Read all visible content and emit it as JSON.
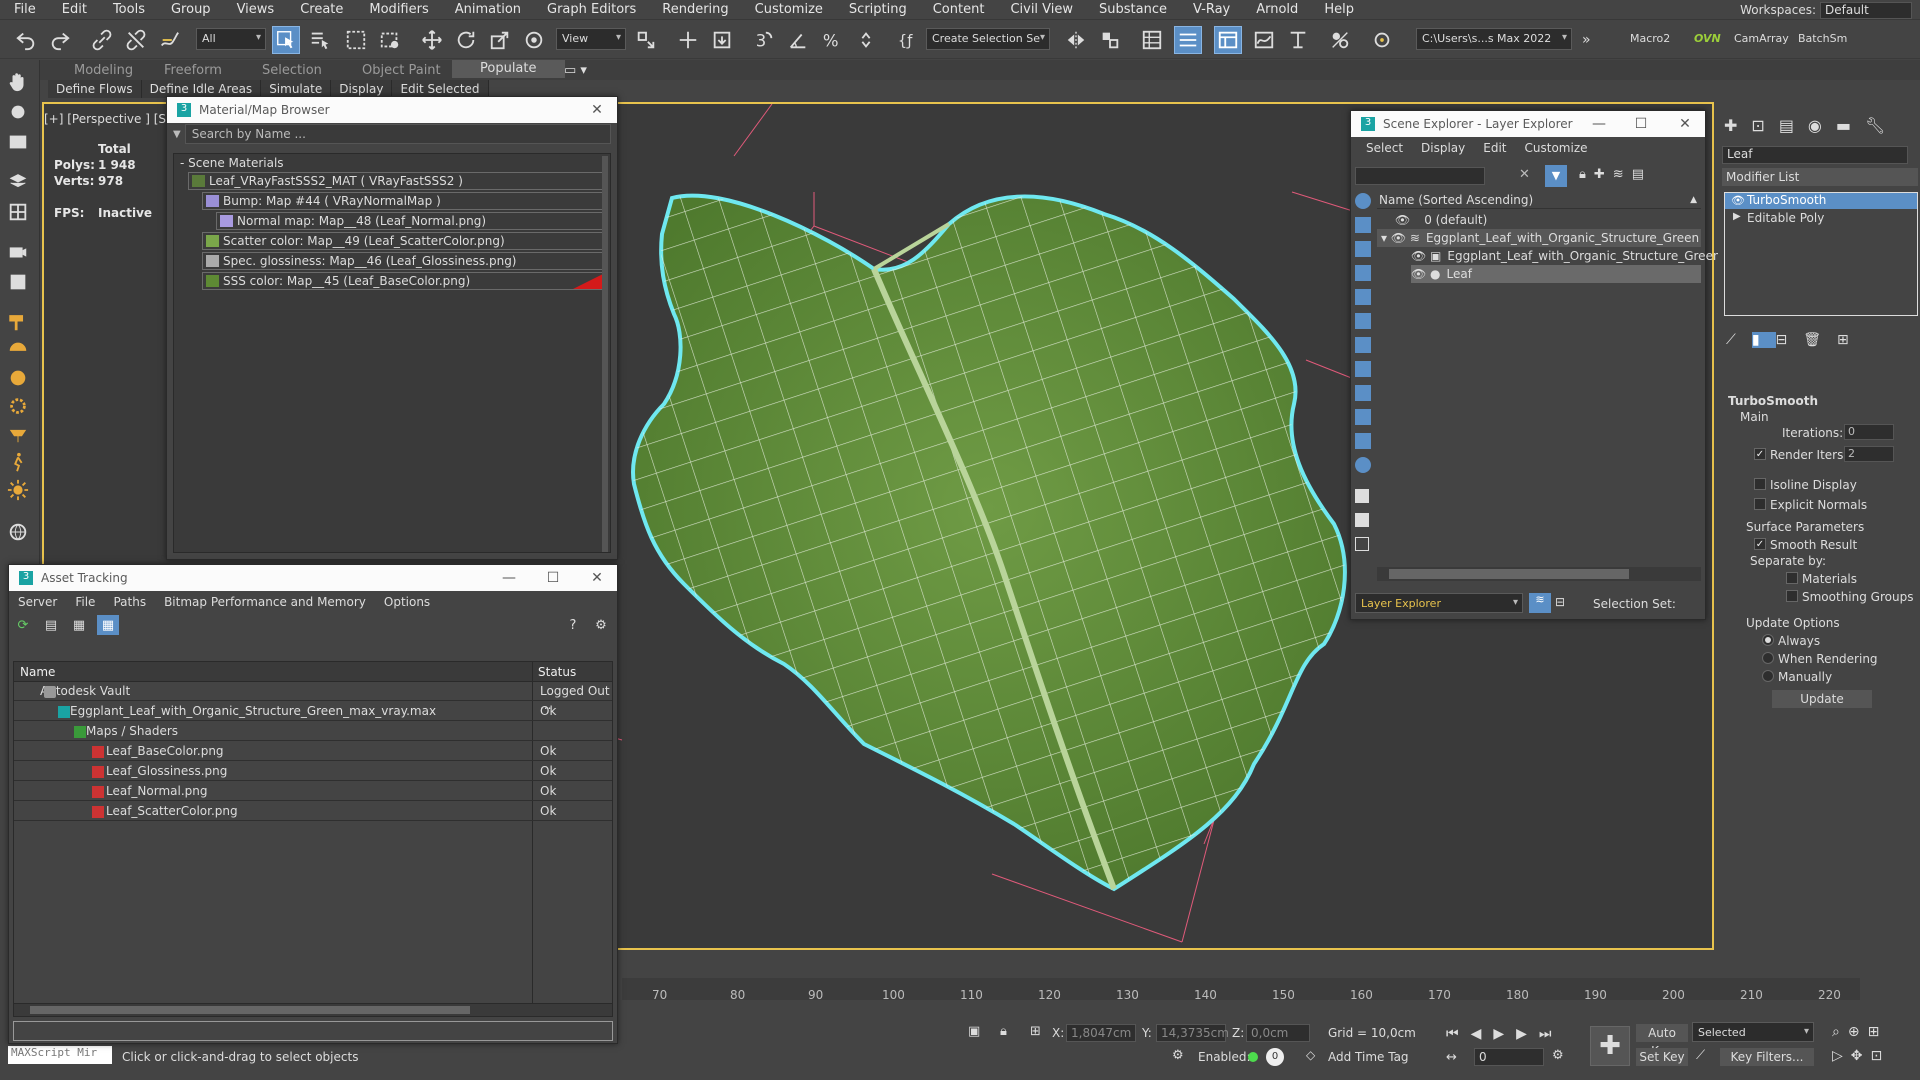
{
  "menu": {
    "items": [
      "File",
      "Edit",
      "Tools",
      "Group",
      "Views",
      "Create",
      "Modifiers",
      "Animation",
      "Graph Editors",
      "Rendering",
      "Customize",
      "Scripting",
      "Content",
      "Civil View",
      "Substance",
      "V-Ray",
      "Arnold",
      "Help"
    ],
    "workspaces_label": "Workspaces:",
    "workspaces_value": "Default"
  },
  "toolbar": {
    "filter_value": "All",
    "refcoord_value": "View",
    "selection_set_placeholder": "Create Selection Se",
    "path_value": "C:\\Users\\s...s Max 2022",
    "macro2": "Macro2",
    "ovn": "OVN",
    "camarray": "CamArray",
    "batchsm": "BatchSm"
  },
  "ribbon": {
    "tabs": [
      "Modeling",
      "Freeform",
      "Selection",
      "Object Paint",
      "Populate"
    ],
    "sub": [
      "Define Flows",
      "Define Idle Areas",
      "Simulate",
      "Display",
      "Edit Selected"
    ]
  },
  "viewport": {
    "label": "[+] [Perspective ] [St",
    "total": "Total",
    "polys_label": "Polys:",
    "polys_value": "1 948",
    "verts_label": "Verts:",
    "verts_value": "978",
    "fps_label": "FPS:",
    "fps_value": "Inactive"
  },
  "material_browser": {
    "title": "Material/Map Browser",
    "search_placeholder": "Search by Name ...",
    "section": "- Scene Materials",
    "items": [
      {
        "label": "Leaf_VRayFastSSS2_MAT  ( VRayFastSSS2 )",
        "color": "#5a7a3a"
      },
      {
        "label": "Bump: Map #44  ( VRayNormalMap )",
        "color": "#9a8fd6"
      },
      {
        "label": "Normal map: Map__48 (Leaf_Normal.png)",
        "color": "#a89ae0"
      },
      {
        "label": "Scatter color: Map__49 (Leaf_ScatterColor.png)",
        "color": "#7aa64a"
      },
      {
        "label": "Spec. glossiness: Map__46 (Leaf_Glossiness.png)",
        "color": "#aaaaaa"
      },
      {
        "label": "SSS color: Map__45 (Leaf_BaseColor.png)",
        "color": "#5e8a34"
      }
    ]
  },
  "asset_tracking": {
    "title": "Asset Tracking",
    "menu": [
      "Server",
      "File",
      "Paths",
      "Bitmap Performance and Memory",
      "Options"
    ],
    "col_name": "Name",
    "col_status": "Status",
    "rows": [
      {
        "name": "Autodesk Vault",
        "status": "Logged Out ..."
      },
      {
        "name": "Eggplant_Leaf_with_Organic_Structure_Green_max_vray.max",
        "status": "Ok"
      },
      {
        "name": "Maps / Shaders",
        "status": ""
      },
      {
        "name": "Leaf_BaseColor.png",
        "status": "Ok"
      },
      {
        "name": "Leaf_Glossiness.png",
        "status": "Ok"
      },
      {
        "name": "Leaf_Normal.png",
        "status": "Ok"
      },
      {
        "name": "Leaf_ScatterColor.png",
        "status": "Ok"
      }
    ]
  },
  "scene_explorer": {
    "title": "Scene Explorer - Layer Explorer",
    "menu": [
      "Select",
      "Display",
      "Edit",
      "Customize"
    ],
    "column": "Name (Sorted Ascending)",
    "rows": [
      "0 (default)",
      "Eggplant_Leaf_with_Organic_Structure_Green",
      "Eggplant_Leaf_with_Organic_Structure_Green",
      "Leaf"
    ],
    "footer_dropdown": "Layer Explorer",
    "selection_set_label": "Selection Set:"
  },
  "modifier_panel": {
    "object_name": "Leaf",
    "modifier_list": "Modifier List",
    "stack": [
      "TurboSmooth",
      "Editable Poly"
    ],
    "rollout": "TurboSmooth",
    "main": "Main",
    "iterations_label": "Iterations:",
    "iterations_value": "0",
    "render_iters_label": "Render Iters:",
    "render_iters_value": "2",
    "isoline": "Isoline Display",
    "explicit": "Explicit Normals",
    "surface": "Surface Parameters",
    "smooth": "Smooth Result",
    "separate": "Separate by:",
    "materials": "Materials",
    "smoothing": "Smoothing Groups",
    "update_options": "Update Options",
    "always": "Always",
    "when_rendering": "When Rendering",
    "manually": "Manually",
    "update_button": "Update"
  },
  "timeline": {
    "ticks": [
      "70",
      "80",
      "90",
      "100",
      "110",
      "120",
      "130",
      "140",
      "150",
      "160",
      "170",
      "180",
      "190",
      "200",
      "210",
      "220"
    ]
  },
  "status": {
    "maxscript": "MAXScript Mir",
    "prompt": "Click or click-and-drag to select objects",
    "x_label": "X:",
    "x_value": "1,8047cm",
    "y_label": "Y:",
    "y_value": "14,3735cm",
    "z_label": "Z:",
    "z_value": "0,0cm",
    "grid": "Grid = 10,0cm",
    "enabled": "Enabled:",
    "add_time_tag": "Add Time Tag",
    "auto_key": "Auto Key",
    "set_key": "Set Key",
    "selected": "Selected",
    "key_filters": "Key Filters...",
    "frame": "0"
  },
  "colors": {
    "accent": "#5b8fc6",
    "viewport_border": "#e8c34d",
    "leaf_edge": "#6fe8f0",
    "leaf_green": "#5f8a3a"
  }
}
